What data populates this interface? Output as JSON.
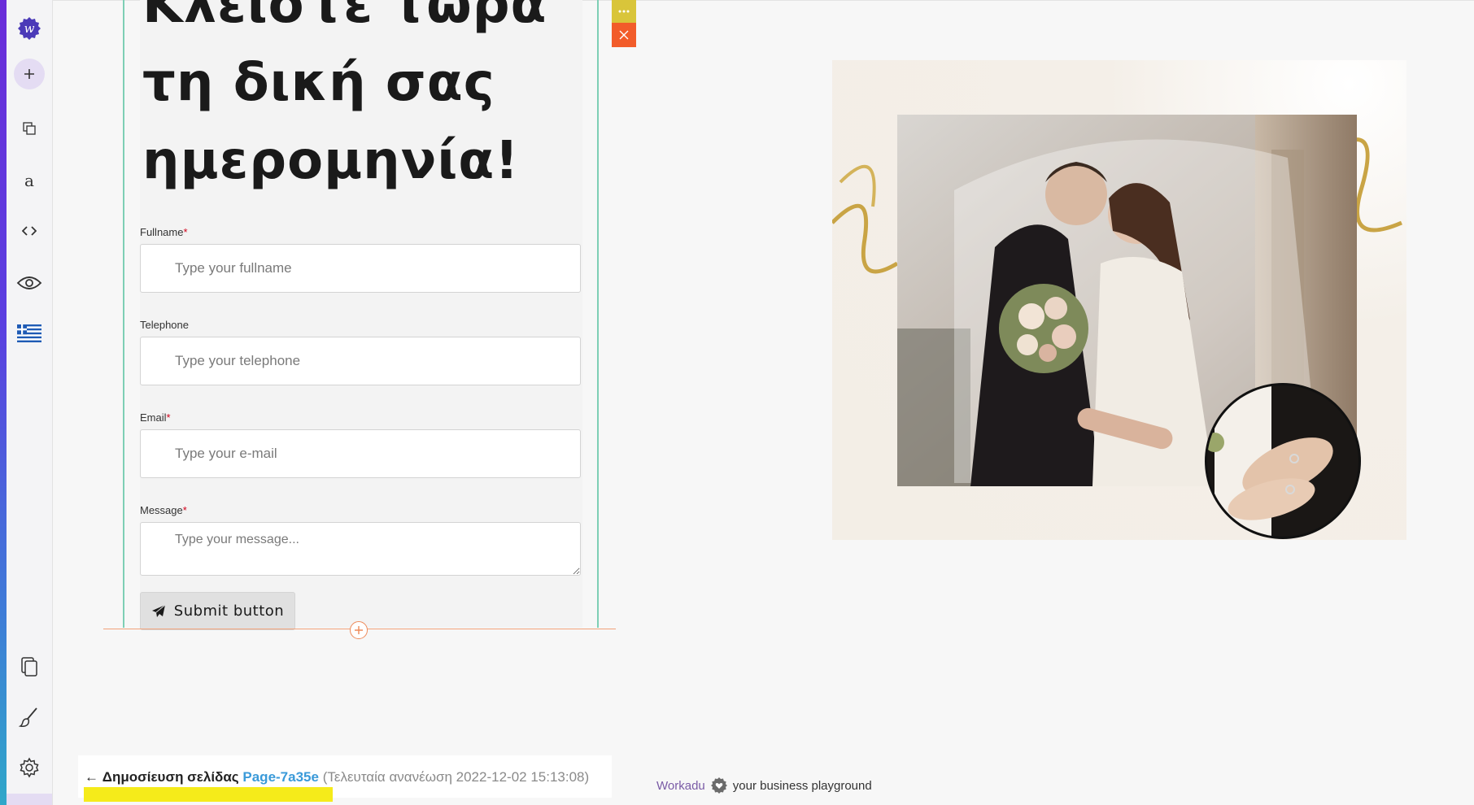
{
  "form": {
    "heading": "Κλείστε τώρα\nτη δική σας\nημερομηνία!",
    "fields": [
      {
        "label": "Fullname",
        "required": true,
        "placeholder": "Type your fullname"
      },
      {
        "label": "Telephone",
        "required": false,
        "placeholder": "Type your telephone"
      },
      {
        "label": "Email",
        "required": true,
        "placeholder": "Type your e-mail"
      },
      {
        "label": "Message",
        "required": true,
        "placeholder": "Type your message..."
      }
    ],
    "required_mark": "*",
    "submit_label": "Submit button"
  },
  "element_toolbar": {
    "more_icon": "more-dots-icon",
    "close_icon": "close-icon"
  },
  "rail": {
    "items": [
      "workadu-logo-icon",
      "add-icon",
      "layers-icon",
      "typography-icon",
      "code-icon",
      "preview-eye-icon",
      "greek-flag-icon",
      "pages-icon",
      "brush-icon",
      "settings-icon"
    ]
  },
  "footer": {
    "back_arrow": "←",
    "publish_label": "Δημοσίευση σελίδας",
    "page_id": "Page-7a35e",
    "last_updated": "(Τελευταία ανανέωση 2022-12-02 15:13:08)",
    "brand_name": "Workadu",
    "brand_tagline": "your business playground"
  },
  "colors": {
    "accent_purple": "#5b3fe0",
    "section_border": "#7ecfb5",
    "close_orange": "#f25c2a",
    "more_yellow": "#d9c53a",
    "link_blue": "#3a9ad9",
    "highlight_yellow": "#f5eb1a"
  },
  "image": {
    "description_icon": "wedding-photo"
  }
}
